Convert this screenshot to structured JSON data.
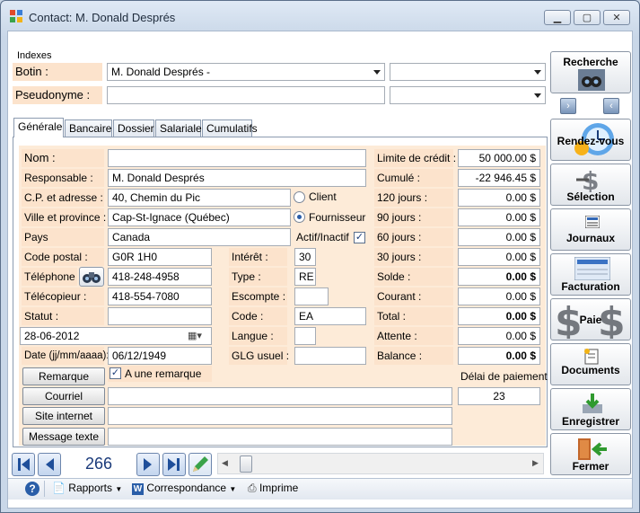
{
  "window": {
    "title": "Contact: M. Donald Després"
  },
  "indexes": {
    "group_label": "Indexes",
    "botin_label": "Botin :",
    "botin_value": "M. Donald Després  -",
    "botin_extra": "",
    "pseudonyme_label": "Pseudonyme :",
    "pseudonyme_value": "",
    "pseudonyme_extra": ""
  },
  "tabs": [
    "Générale",
    "Bancaire",
    "Dossier",
    "Salariale",
    "Cumulatifs"
  ],
  "general": {
    "nom_label": "Nom :",
    "nom_value": "",
    "responsable_label": "Responsable :",
    "responsable_value": "M. Donald Després",
    "cp_label": "C.P. et adresse :",
    "cp_value": "40, Chemin du Pic",
    "ville_label": "Ville et province :",
    "ville_value": "Cap-St-Ignace (Québec)",
    "pays_label": "Pays",
    "pays_value": "Canada",
    "code_postal_label": "Code postal :",
    "code_postal_value": "G0R 1H0",
    "telephone_label": "Téléphone :",
    "telephone_value": "418-248-4958",
    "telecopieur_label": "Télécopieur :",
    "telecopieur_value": "418-554-7080",
    "statut_label": "Statut :",
    "statut_value": "",
    "date_picker_value": "28-06-2012",
    "date_label": "Date (jj/mm/aaaa):",
    "date_value": "06/12/1949",
    "remarque_button": "Remarque",
    "remarque_check_label": "A une remarque",
    "courriel_button": "Courriel",
    "courriel_value": "",
    "site_button": "Site internet",
    "site_value": "",
    "message_button": "Message texte",
    "message_value": "",
    "client_label": "Client",
    "fournisseur_label": "Fournisseur",
    "actif_label": "Actif/Inactif",
    "interet_label": "Intérêt :",
    "interet_value": "30",
    "type_label": "Type :",
    "type_value": "RE",
    "escompte_label": "Escompte :",
    "escompte_value": "",
    "code_label": "Code :",
    "code_value": "EA",
    "langue_label": "Langue :",
    "langue_value": "",
    "glg_label": "GLG usuel :",
    "glg_value": ""
  },
  "finance": [
    {
      "label": "Limite de crédit :",
      "value": "50 000.00 $",
      "bold": false
    },
    {
      "label": "Cumulé :",
      "value": "-22 946.45 $",
      "bold": false
    },
    {
      "label": "120 jours :",
      "value": "0.00 $",
      "bold": false
    },
    {
      "label": "90 jours :",
      "value": "0.00 $",
      "bold": false
    },
    {
      "label": "60 jours :",
      "value": "0.00 $",
      "bold": false
    },
    {
      "label": "30 jours :",
      "value": "0.00 $",
      "bold": false
    },
    {
      "label": "Solde :",
      "value": "0.00 $",
      "bold": true
    },
    {
      "label": "Courant :",
      "value": "0.00 $",
      "bold": false
    },
    {
      "label": "Total :",
      "value": "0.00 $",
      "bold": true
    },
    {
      "label": "Attente :",
      "value": "0.00 $",
      "bold": false
    },
    {
      "label": "Balance :",
      "value": "0.00 $",
      "bold": true
    }
  ],
  "delai": {
    "label": "Délai de paiement",
    "value": "23"
  },
  "sidebar": {
    "recherche": "Recherche",
    "rendezvous": "Rendez-vous",
    "selection": "Sélection",
    "journaux": "Journaux",
    "facturation": "Facturation",
    "paie": "Paie",
    "documents": "Documents",
    "enregistrer": "Enregistrer",
    "fermer": "Fermer"
  },
  "nav": {
    "record_number": "266"
  },
  "statusbar": {
    "rapports": "Rapports",
    "correspondance": "Correspondance",
    "imprime": "Imprime"
  },
  "colors": {
    "field_label_bg": "#fce3cc",
    "tab_bg": "#fdebd8",
    "accent_blue": "#1f4f9a"
  }
}
